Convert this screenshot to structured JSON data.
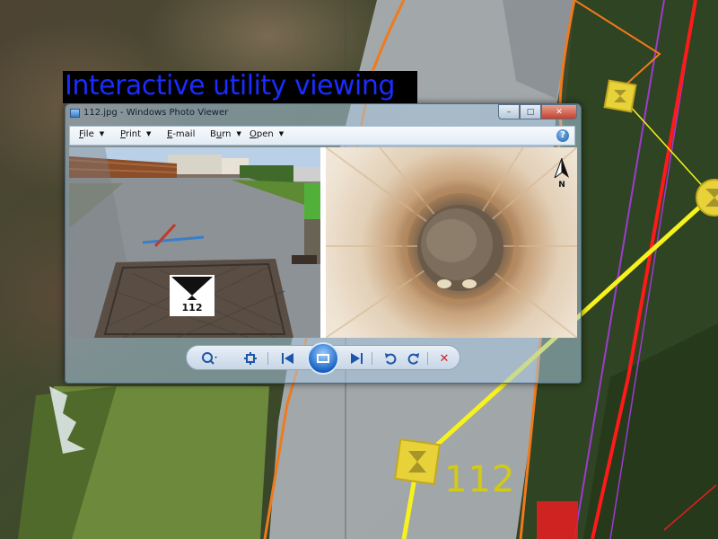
{
  "banner": {
    "title": "Interactive utility viewing"
  },
  "viewer": {
    "window_title": "112.jpg - Windows Photo Viewer",
    "menu": [
      {
        "label": "File",
        "accel": "F"
      },
      {
        "label": "Print",
        "accel": "P"
      },
      {
        "label": "E-mail",
        "accel": "E"
      },
      {
        "label": "Burn",
        "accel": "u"
      },
      {
        "label": "Open",
        "accel": "O"
      }
    ],
    "help_glyph": "?",
    "left_photo": {
      "marker_number": "112"
    },
    "right_photo": {
      "compass_letter": "N"
    },
    "toolbar": [
      "zoom-icon",
      "fit-window-icon",
      "previous-icon",
      "slideshow-icon",
      "next-icon",
      "rotate-left-icon",
      "rotate-right-icon",
      "delete-icon"
    ]
  },
  "map": {
    "manhole_label": "112",
    "colors": {
      "utility_line": "#f7f21e",
      "boundary": "#ff1a1a",
      "road_edge": "#f07a1c",
      "pipe": "#9b3ccf"
    }
  }
}
